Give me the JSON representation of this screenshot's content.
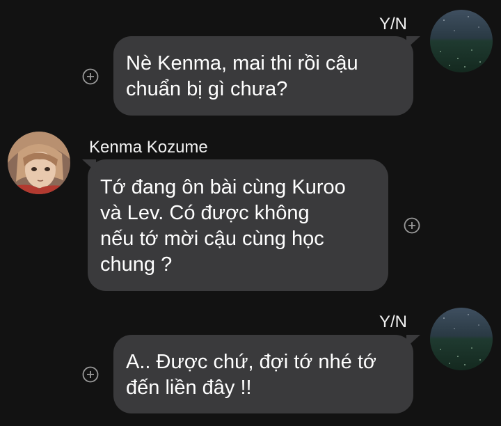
{
  "messages": [
    {
      "sender": "Y/N",
      "side": "right",
      "lines": [
        "Nè Kenma, mai thi rồi cậu",
        "chuẩn bị gì chưa?"
      ],
      "avatar_icon": "night-meadow-avatar",
      "reaction_icon": "add-reaction-icon"
    },
    {
      "sender": "Kenma Kozume",
      "side": "left",
      "lines": [
        "Tớ đang ôn bài cùng Kuroo",
        "và Lev. Có được không",
        "nếu tớ mời cậu cùng học",
        "chung ?"
      ],
      "avatar_icon": "anime-character-avatar",
      "reaction_icon": "add-reaction-icon"
    },
    {
      "sender": "Y/N",
      "side": "right",
      "lines": [
        "A.. Được chứ, đợi tớ nhé tớ",
        "đến liền đây !!"
      ],
      "avatar_icon": "night-meadow-avatar",
      "reaction_icon": "add-reaction-icon"
    }
  ],
  "colors": {
    "background": "#121212",
    "bubble": "#3a3a3c",
    "text": "#ffffff",
    "icon": "#9a9a9a"
  }
}
